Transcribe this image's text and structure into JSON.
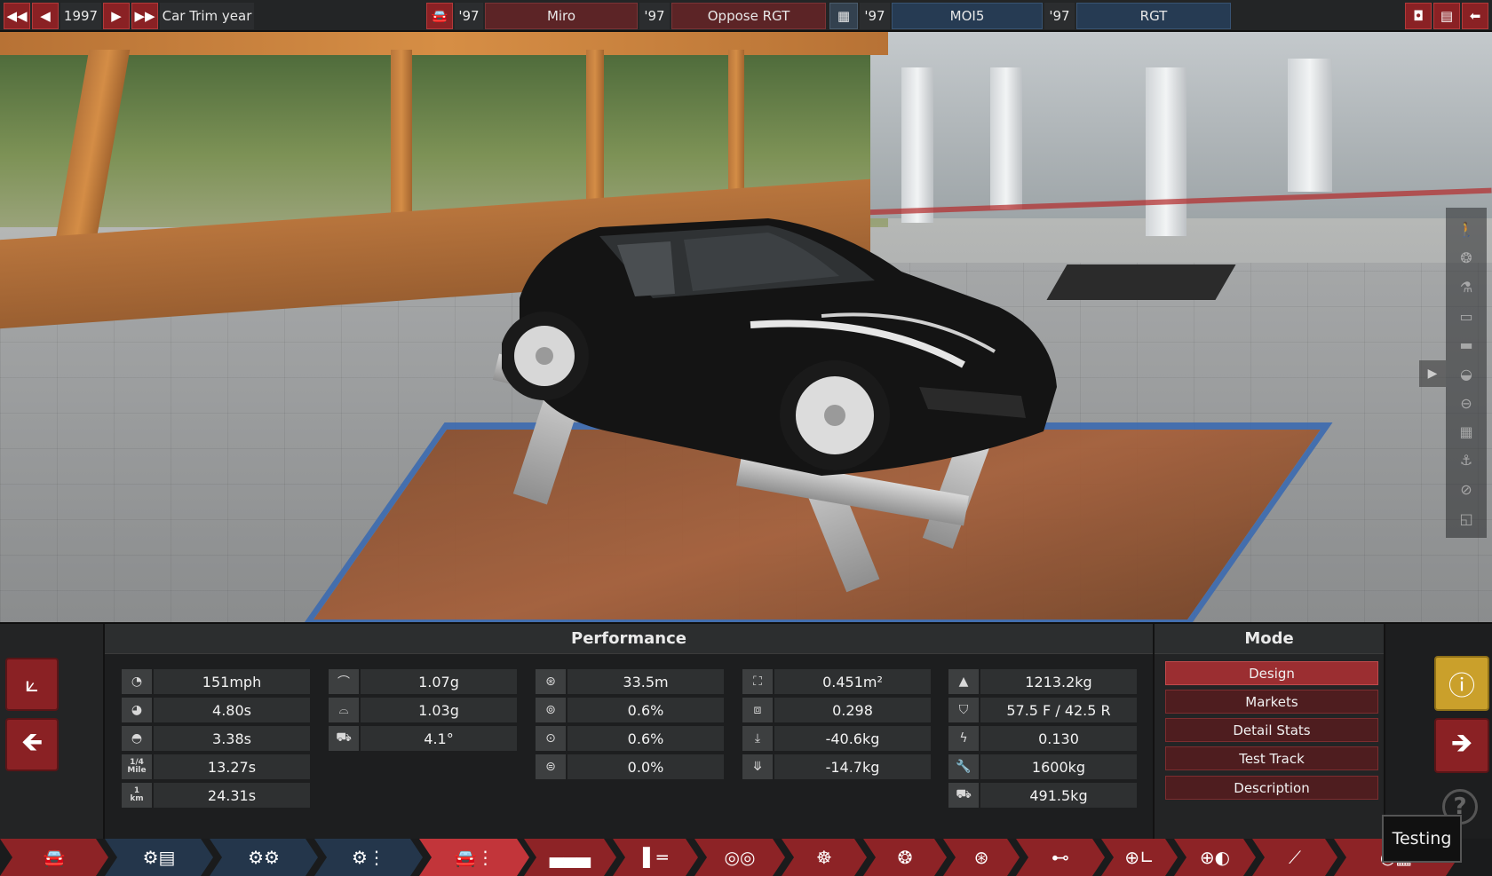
{
  "topbar": {
    "year_controls": {
      "first_icon": "double-left-icon",
      "prev_icon": "left-icon",
      "year": "1997",
      "next_icon": "right-icon",
      "last_icon": "double-right-icon",
      "label": "Car Trim year"
    },
    "model_icon": "car-icon",
    "model_year": "'97",
    "model_name": "Miro",
    "trim_year": "'97",
    "trim_name": "Oppose RGT",
    "engine_icon": "engine-block-icon",
    "engine_year": "'97",
    "engine_name": "MOI5",
    "variant_year": "'97",
    "variant_name": "RGT",
    "right_icons": [
      "camera-icon",
      "calculator-icon",
      "back-arrow-icon"
    ]
  },
  "scene": {
    "side_icons": [
      "person-icon",
      "wheel-icon",
      "bottle-icon",
      "car-side-icon",
      "panel-icon",
      "car-front-icon",
      "chassis-icon",
      "grille-icon",
      "seat-icon",
      "no-sign-icon",
      "square-icon"
    ],
    "expand_icon": "triangle-right-icon"
  },
  "performance": {
    "title": "Performance",
    "columns": [
      [
        {
          "icon": "speedometer-icon",
          "value": "151mph"
        },
        {
          "icon": "gauge-accel-icon",
          "value": "4.80s"
        },
        {
          "icon": "gauge-icon",
          "value": "3.38s"
        },
        {
          "icon_text": "1/4 Mile",
          "value": "13.27s"
        },
        {
          "icon_text": "1 km",
          "value": "24.31s"
        }
      ],
      [
        {
          "icon": "corner-grip-icon",
          "value": "1.07g"
        },
        {
          "icon": "corner-grip-2-icon",
          "value": "1.03g"
        },
        {
          "icon": "body-roll-icon",
          "value": "4.1°"
        }
      ],
      [
        {
          "icon": "brake-disc-icon",
          "value": "33.5m"
        },
        {
          "icon": "brake-fade-icon",
          "value": "0.6%"
        },
        {
          "icon": "brake-fade-2-icon",
          "value": "0.6%"
        },
        {
          "icon": "brake-fade-3-icon",
          "value": "0.0%"
        }
      ],
      [
        {
          "icon": "frontal-area-icon",
          "value": "0.451m²"
        },
        {
          "icon": "drag-coefficient-icon",
          "value": "0.298"
        },
        {
          "icon": "front-downforce-icon",
          "value": "-40.6kg"
        },
        {
          "icon": "rear-downforce-icon",
          "value": "-14.7kg"
        }
      ],
      [
        {
          "icon": "weight-icon",
          "value": "1213.2kg"
        },
        {
          "icon": "weight-distribution-icon",
          "value": "57.5 F / 42.5 R"
        },
        {
          "icon": "lightning-icon",
          "value": "0.130"
        },
        {
          "icon": "wrench-icon",
          "value": "1600kg"
        },
        {
          "icon": "tow-icon",
          "value": "491.5kg"
        }
      ]
    ]
  },
  "mode": {
    "title": "Mode",
    "buttons": [
      "Design",
      "Markets",
      "Detail Stats",
      "Test Track",
      "Description"
    ],
    "active": "Design"
  },
  "nav": {
    "graph_icon": "graph-axes-icon",
    "back_icon": "arrow-left-icon",
    "warning_icon": "exclamation-icon",
    "next_icon": "arrow-right-icon",
    "help_icon": "question-icon"
  },
  "tabs": [
    {
      "icon": "car-front-tab-icon"
    },
    {
      "icon": "model-folder-icon"
    },
    {
      "icon": "model-family-icon"
    },
    {
      "icon": "model-tree-icon"
    },
    {
      "icon": "trim-tree-icon"
    },
    {
      "icon": "chassis-tab-icon"
    },
    {
      "icon": "suspension-tab-icon"
    },
    {
      "icon": "headlights-tab-icon"
    },
    {
      "icon": "gears-tab-icon"
    },
    {
      "icon": "wheel-tab-icon"
    },
    {
      "icon": "brakes-tab-icon"
    },
    {
      "icon": "aero-tab-icon"
    },
    {
      "icon": "interior-tab-icon"
    },
    {
      "icon": "steering-tab-icon"
    },
    {
      "icon": "fuel-tab-icon"
    },
    {
      "icon": "testing-tab-icon"
    }
  ],
  "tooltip": "Testing",
  "colors": {
    "accent_red": "#8a2124",
    "selected_red": "#c2353a",
    "engine_blue": "#263b53",
    "warning_yellow": "#caa02b"
  }
}
